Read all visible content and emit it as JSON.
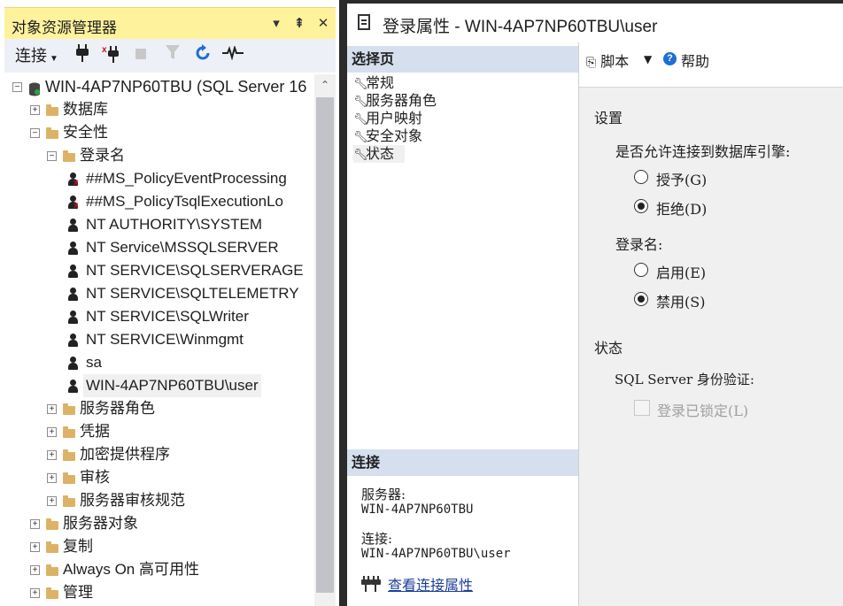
{
  "object_explorer": {
    "title": "对象资源管理器",
    "pin_glyph": "▾",
    "pin2_glyph": "⊐",
    "close_glyph": "✕",
    "toolbar": {
      "connect_label": "连接"
    },
    "tree": [
      {
        "label": "WIN-4AP7NP60TBU (SQL Server 16",
        "icon": "server-icon",
        "expander": "−",
        "level": 0
      },
      {
        "label": "数据库",
        "icon": "folder-icon",
        "expander": "+",
        "level": 1
      },
      {
        "label": "安全性",
        "icon": "folder-icon",
        "expander": "−",
        "level": 1
      },
      {
        "label": "登录名",
        "icon": "folder-icon",
        "expander": "−",
        "level": 2
      },
      {
        "label": "##MS_PolicyEventProcessing",
        "icon": "user-disabled-icon",
        "level": 3
      },
      {
        "label": "##MS_PolicyTsqlExecutionLo",
        "icon": "user-disabled-icon",
        "level": 3
      },
      {
        "label": "NT AUTHORITY\\SYSTEM",
        "icon": "user-icon",
        "level": 3
      },
      {
        "label": "NT Service\\MSSQLSERVER",
        "icon": "user-icon",
        "level": 3
      },
      {
        "label": "NT SERVICE\\SQLSERVERAGE",
        "icon": "user-icon",
        "level": 3
      },
      {
        "label": "NT SERVICE\\SQLTELEMETRY",
        "icon": "user-icon",
        "level": 3
      },
      {
        "label": "NT SERVICE\\SQLWriter",
        "icon": "user-icon",
        "level": 3
      },
      {
        "label": "NT SERVICE\\Winmgmt",
        "icon": "user-icon",
        "level": 3
      },
      {
        "label": "sa",
        "icon": "user-icon",
        "level": 3
      },
      {
        "label": "WIN-4AP7NP60TBU\\user",
        "icon": "user-icon",
        "level": 3,
        "selected": true
      },
      {
        "label": "服务器角色",
        "icon": "folder-icon",
        "expander": "+",
        "level": 2
      },
      {
        "label": "凭据",
        "icon": "folder-icon",
        "expander": "+",
        "level": 2
      },
      {
        "label": "加密提供程序",
        "icon": "folder-icon",
        "expander": "+",
        "level": 2
      },
      {
        "label": "审核",
        "icon": "folder-icon",
        "expander": "+",
        "level": 2
      },
      {
        "label": "服务器审核规范",
        "icon": "folder-icon",
        "expander": "+",
        "level": 2
      },
      {
        "label": "服务器对象",
        "icon": "folder-icon",
        "expander": "+",
        "level": 1
      },
      {
        "label": "复制",
        "icon": "folder-icon",
        "expander": "+",
        "level": 1
      },
      {
        "label": "Always On 高可用性",
        "icon": "folder-icon",
        "expander": "+",
        "level": 1
      },
      {
        "label": "管理",
        "icon": "folder-icon",
        "expander": "+",
        "level": 1
      }
    ]
  },
  "dialog": {
    "title": "登录属性 - WIN-4AP7NP60TBU\\user",
    "select_page": {
      "header": "选择页",
      "items": [
        "常规",
        "服务器角色",
        "用户映射",
        "安全对象",
        "状态"
      ]
    },
    "connection": {
      "header": "连接",
      "server_label": "服务器:",
      "server_value": "WIN-4AP7NP60TBU",
      "connection_label": "连接:",
      "connection_value": "WIN-4AP7NP60TBU\\user",
      "view_link": "查看连接属性"
    },
    "toolbar": {
      "script_label": "脚本",
      "help_label": "帮助"
    },
    "settings": {
      "header": "设置",
      "permission_question": "是否允许连接到数据库引擎:",
      "grant_label": "授予(G)",
      "deny_label": "拒绝(D)",
      "deny_selected": true,
      "login_label": "登录名:",
      "enable_label": "启用(E)",
      "disable_label": "禁用(S)",
      "disable_selected": true
    },
    "status": {
      "header": "状态",
      "auth_label": "SQL Server 身份验证:",
      "locked_label": "登录已锁定(L)",
      "locked_checked": false
    }
  },
  "colors": {
    "title_highlight": "#fff29d",
    "section_header": "#d5dfee",
    "selected_row": "#f0f0f0",
    "link": "#1c3e9b"
  }
}
